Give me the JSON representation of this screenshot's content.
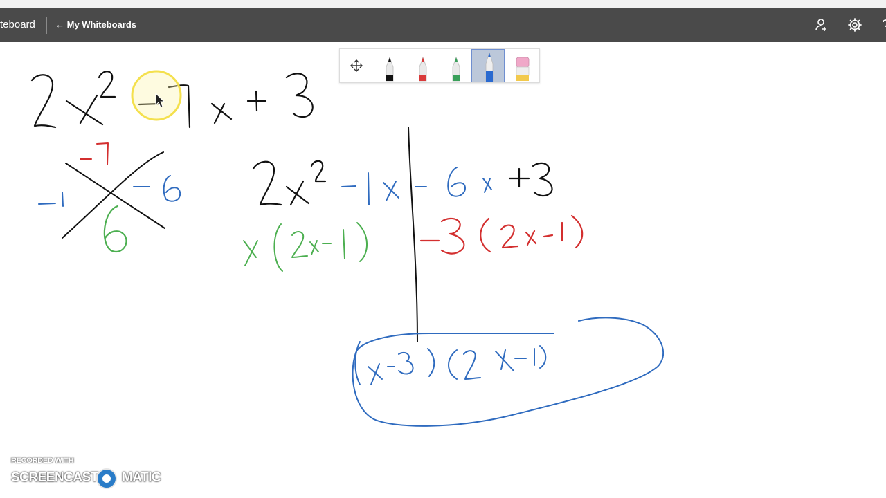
{
  "app_bar": {
    "title": "teboard",
    "back_label": "← My Whiteboards",
    "icons": [
      "user-add-icon",
      "gear-icon",
      "help-icon"
    ]
  },
  "toolbar": {
    "tools": [
      {
        "name": "move-tool",
        "icon": "move-arrows-icon"
      },
      {
        "name": "black-marker",
        "color": "#1a1a1a"
      },
      {
        "name": "red-marker",
        "color": "#d93a3a"
      },
      {
        "name": "green-marker",
        "color": "#3aa05a"
      },
      {
        "name": "blue-marker",
        "color": "#2a6ad0",
        "selected": true
      },
      {
        "name": "eraser",
        "color": "#f0a8c8"
      }
    ]
  },
  "colors": {
    "ink_black": "#111111",
    "ink_red": "#d32f2f",
    "ink_green": "#4caf50",
    "ink_blue": "#2f6bbf",
    "highlight": "#f4e04d",
    "app_bar": "#4a4a4a"
  },
  "board": {
    "equation": "2x² – 7x + 3",
    "factor_product": "-7",
    "factor_pair_left": "-1",
    "factor_pair_right": "-6",
    "factor_bottom": "6",
    "split_left": "2x² – 1x",
    "split_right": "– 6x + 3",
    "group_left": "x(2x – 1)",
    "group_right": "– 3(2x – 1)",
    "answer": "(x – 3)(2x – 1)"
  },
  "watermark": {
    "recorded_with": "RECORDED WITH",
    "left_word": "SCREENCAST",
    "right_word": "MATIC"
  }
}
